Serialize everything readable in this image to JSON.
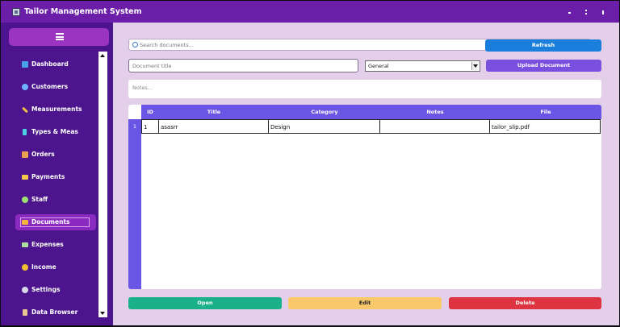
{
  "window": {
    "title": "Tailor Management System",
    "controls": [
      "minimize",
      "maximize",
      "close"
    ]
  },
  "sidebar": {
    "menu_icon": "hamburger-icon",
    "items": [
      {
        "label": "Dashboard",
        "icon": "chart-icon",
        "color": "#4aa0e8"
      },
      {
        "label": "Customers",
        "icon": "people-icon",
        "color": "#6fb3ff"
      },
      {
        "label": "Measurements",
        "icon": "ruler-icon",
        "color": "#f0c040"
      },
      {
        "label": "Types & Meas",
        "icon": "spool-icon",
        "color": "#4ad0e0"
      },
      {
        "label": "Orders",
        "icon": "box-icon",
        "color": "#e8a050"
      },
      {
        "label": "Payments",
        "icon": "card-icon",
        "color": "#f4c84a"
      },
      {
        "label": "Staff",
        "icon": "group-icon",
        "color": "#9be070"
      },
      {
        "label": "Documents",
        "icon": "folder-icon",
        "color": "#f3b43c",
        "active": true
      },
      {
        "label": "Expenses",
        "icon": "money-icon",
        "color": "#b0e0a0"
      },
      {
        "label": "Income",
        "icon": "moneybag-icon",
        "color": "#f0c030"
      },
      {
        "label": "Settings",
        "icon": "gear-icon",
        "color": "#d8d8e8"
      },
      {
        "label": "Data Browser",
        "icon": "file-icon",
        "color": "#e8c890"
      }
    ]
  },
  "main": {
    "search": {
      "placeholder": "Search documents..."
    },
    "refresh_label": "Refresh",
    "title_field": {
      "placeholder": "Document title"
    },
    "category_select": {
      "value": "General"
    },
    "upload_label": "Upload Document",
    "notes": {
      "placeholder": "Notes..."
    },
    "table": {
      "columns": [
        "ID",
        "Title",
        "Category",
        "Notes",
        "File"
      ],
      "rows": [
        {
          "num": "1",
          "id": "1",
          "title": "asasrr",
          "category": "Design",
          "notes": "",
          "file": "tailor_slip.pdf"
        }
      ]
    },
    "actions": {
      "open_label": "Open",
      "edit_label": "Edit",
      "delete_label": "Delete"
    }
  }
}
